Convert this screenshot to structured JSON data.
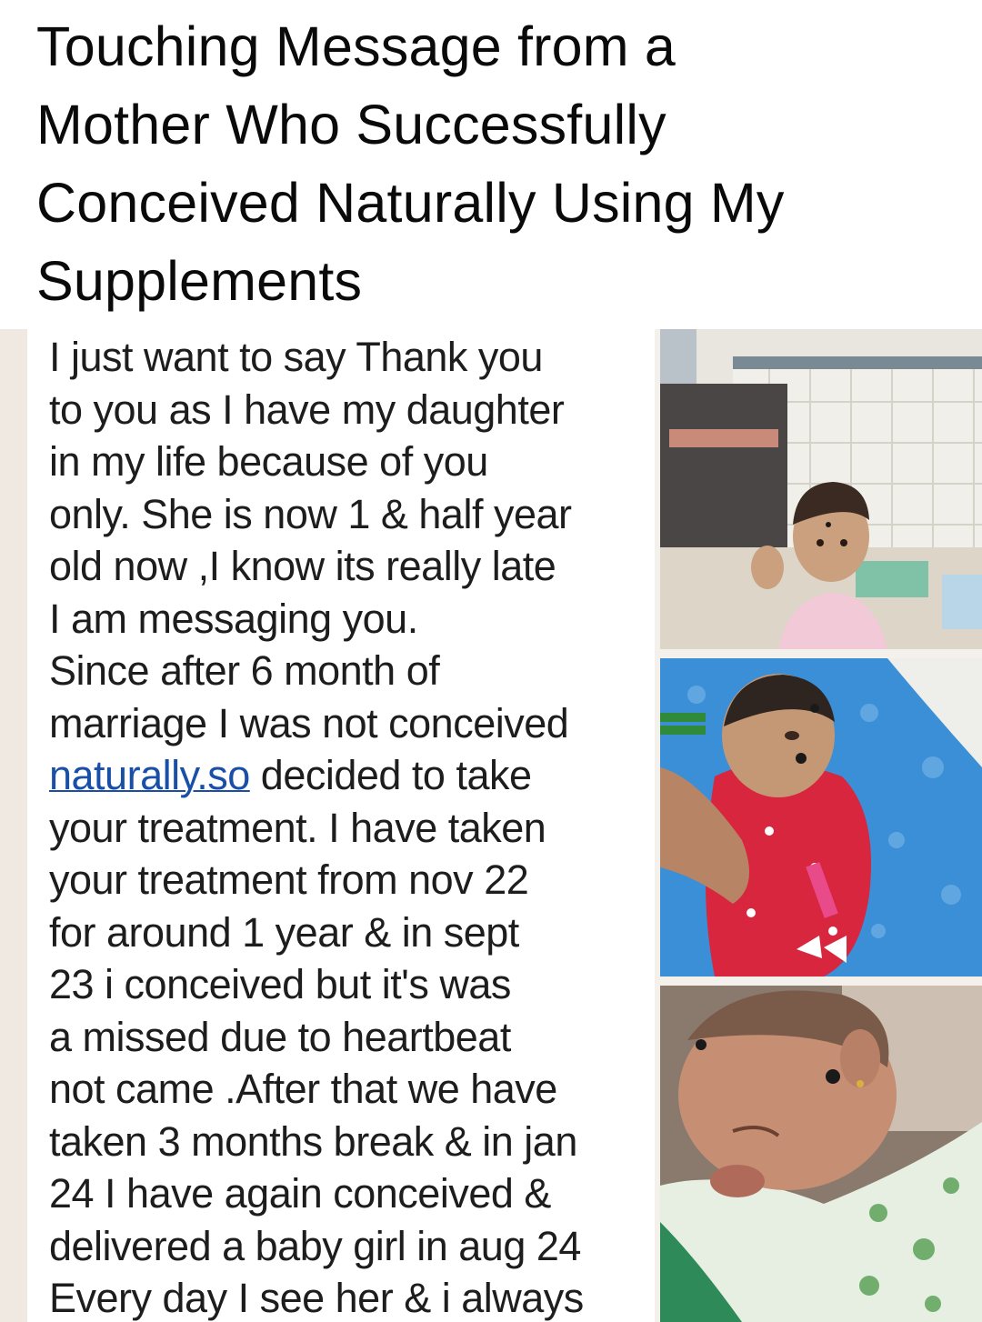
{
  "headline": {
    "lines": [
      "Touching Message from a",
      "Mother Who Successfully",
      "Conceived Naturally Using My",
      "Supplements"
    ]
  },
  "message": {
    "lines": [
      "I just want to say Thank you",
      "to you as I have  my daughter",
      "in my life because of you",
      "only. She is now 1 & half year",
      "old now ,I know its really late",
      "I am messaging you.",
      "Since after 6 month of",
      "marriage I was not conceived",
      "decided to take",
      "your treatment. I have taken",
      "your treatment from nov 22",
      "for around 1 year & in sept",
      "23 i conceived but it's was",
      "a missed due to heartbeat",
      "not  came .After that we have",
      "taken 3 months break & in jan",
      "24 I have again conceived &",
      "delivered a baby girl in aug 24",
      "Every day I see her & i always"
    ],
    "link_text": "naturally.so"
  },
  "photos": {
    "icons": [
      "toddler-photo",
      "infant-photo",
      "newborn-photo"
    ],
    "colors": {
      "link": "#1a4fa8",
      "dress_red": "#d7263d",
      "blanket_blue": "#3b8fd6"
    }
  }
}
